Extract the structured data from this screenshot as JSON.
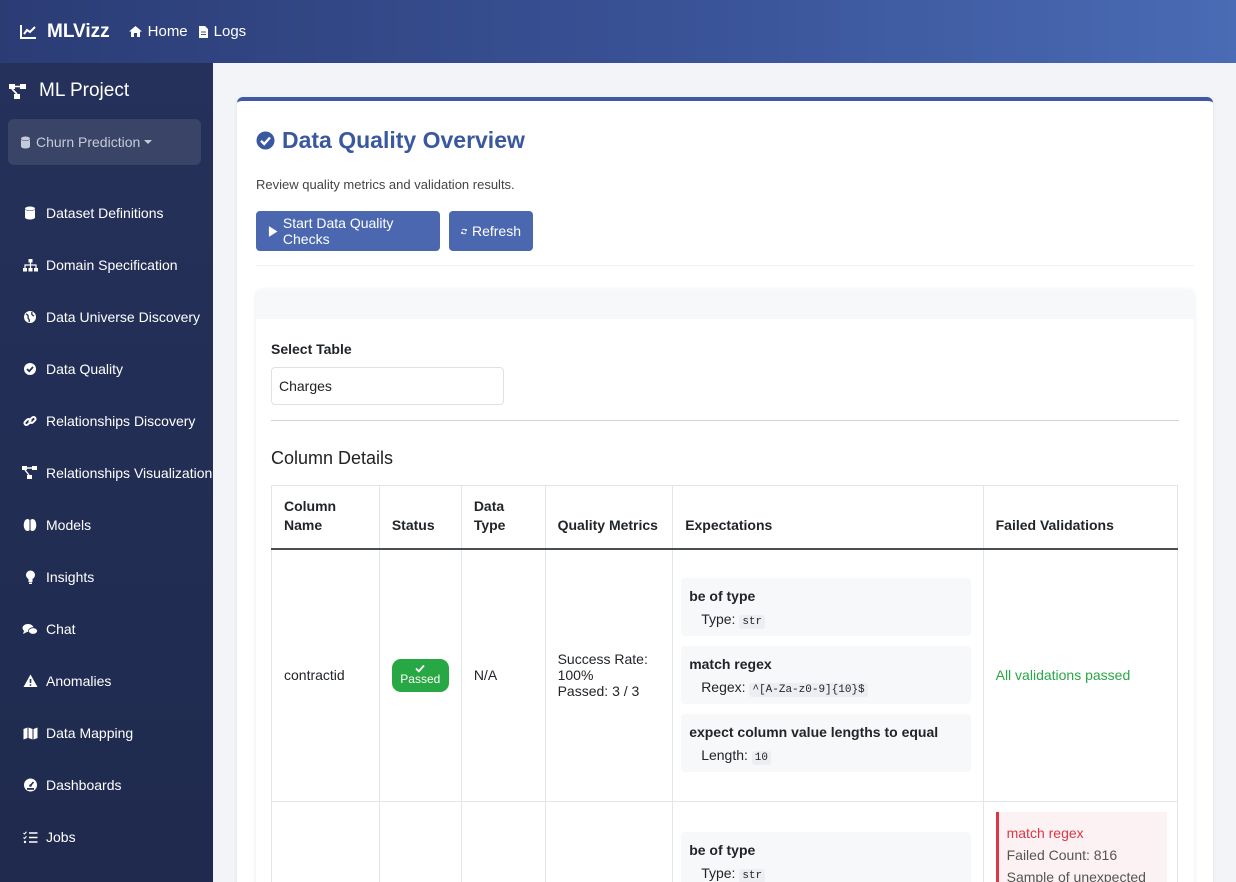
{
  "navbar": {
    "brand": "MLVizz",
    "links": [
      {
        "label": "Home",
        "icon": "home-icon"
      },
      {
        "label": "Logs",
        "icon": "file-icon"
      }
    ]
  },
  "sidebar": {
    "project_title": "ML Project",
    "project_selected": "Churn Prediction",
    "items": [
      {
        "label": "Dataset Definitions",
        "icon": "database-icon"
      },
      {
        "label": "Domain Specification",
        "icon": "sitemap-icon"
      },
      {
        "label": "Data Universe Discovery",
        "icon": "globe-icon"
      },
      {
        "label": "Data Quality",
        "icon": "check-circle-icon"
      },
      {
        "label": "Relationships Discovery",
        "icon": "link-icon"
      },
      {
        "label": "Relationships Visualization",
        "icon": "project-diagram-icon"
      },
      {
        "label": "Models",
        "icon": "brain-icon"
      },
      {
        "label": "Insights",
        "icon": "lightbulb-icon"
      },
      {
        "label": "Chat",
        "icon": "comments-icon"
      },
      {
        "label": "Anomalies",
        "icon": "warning-icon"
      },
      {
        "label": "Data Mapping",
        "icon": "map-icon"
      },
      {
        "label": "Dashboards",
        "icon": "dashboard-icon"
      },
      {
        "label": "Jobs",
        "icon": "tasks-icon"
      }
    ]
  },
  "main": {
    "title": "Data Quality Overview",
    "subtitle": "Review quality metrics and validation results.",
    "start_button": "Start Data Quality Checks",
    "refresh_button": "Refresh",
    "select_label": "Select Table",
    "select_value": "Charges",
    "column_details_title": "Column Details",
    "table": {
      "headers": [
        "Column Name",
        "Status",
        "Data Type",
        "Quality Metrics",
        "Expectations",
        "Failed Validations"
      ],
      "rows": [
        {
          "column": "contractid",
          "status": "Passed",
          "data_type": "N/A",
          "success_rate": "Success Rate: 100%",
          "passed": "Passed: 3 / 3",
          "expectations": [
            {
              "title": "be of type",
              "label": "Type:",
              "value": "str"
            },
            {
              "title": "match regex",
              "label": "Regex:",
              "value": "^[A-Za-z0-9]{10}$"
            },
            {
              "title": "expect column value lengths to equal",
              "label": "Length:",
              "value": "10"
            }
          ],
          "failed": "All validations passed"
        },
        {
          "expectations": [
            {
              "title": "be of type",
              "label": "Type:",
              "value": "str"
            }
          ],
          "failed_title": "match regex",
          "failed_count": "Failed Count: 816",
          "failed_sample": "Sample of unexpected"
        }
      ]
    }
  },
  "colors": {
    "accent": "#3a58a0",
    "button": "#4a67b0",
    "success": "#28a745",
    "danger": "#dc3545",
    "sidebar": "#25315a"
  }
}
